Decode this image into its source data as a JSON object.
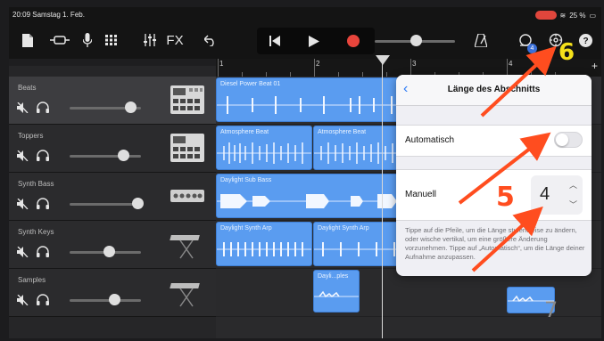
{
  "status": {
    "time_date": "20:09  Samstag 1. Feb.",
    "battery": "25 %"
  },
  "toolbar": {
    "fx_label": "FX",
    "notification_count": "4"
  },
  "ruler": {
    "bars": [
      "1",
      "2",
      "3",
      "4"
    ]
  },
  "tracks": [
    {
      "name": "Beats",
      "volume": 0.85
    },
    {
      "name": "Toppers",
      "volume": 0.75
    },
    {
      "name": "Synth Bass",
      "volume": 0.95
    },
    {
      "name": "Synth Keys",
      "volume": 0.55
    },
    {
      "name": "Samples",
      "volume": 0.62
    }
  ],
  "regions": {
    "beats_1": "Diesel Power Beat 01",
    "toppers_1": "Atmosphere Beat",
    "toppers_2": "Atmosphere Beat",
    "bass_1": "Daylight Sub Bass",
    "keys_1": "Daylight Synth Arp",
    "keys_2": "Daylight Synth Arp",
    "samples_1": "Dayli...ples"
  },
  "popover": {
    "title": "Länge des Abschnitts",
    "auto_label": "Automatisch",
    "auto_on": false,
    "manual_label": "Manuell",
    "manual_value": "4",
    "help": "Tippe auf die Pfeile, um die Länge stufenweise zu ändern, oder wische vertikal, um eine größere Änderung vorzunehmen. Tippe auf „Automatisch“, um die Länge deiner Aufnahme anzupassen."
  },
  "annotations": {
    "step_5": "5",
    "step_6": "6",
    "step_7": "7"
  },
  "colors": {
    "region": "#5a9cf0",
    "record": "#e8453c",
    "accent": "#2f7cf6",
    "annotation_orange": "#ff4d1f",
    "annotation_yellow": "#f5e11a"
  }
}
